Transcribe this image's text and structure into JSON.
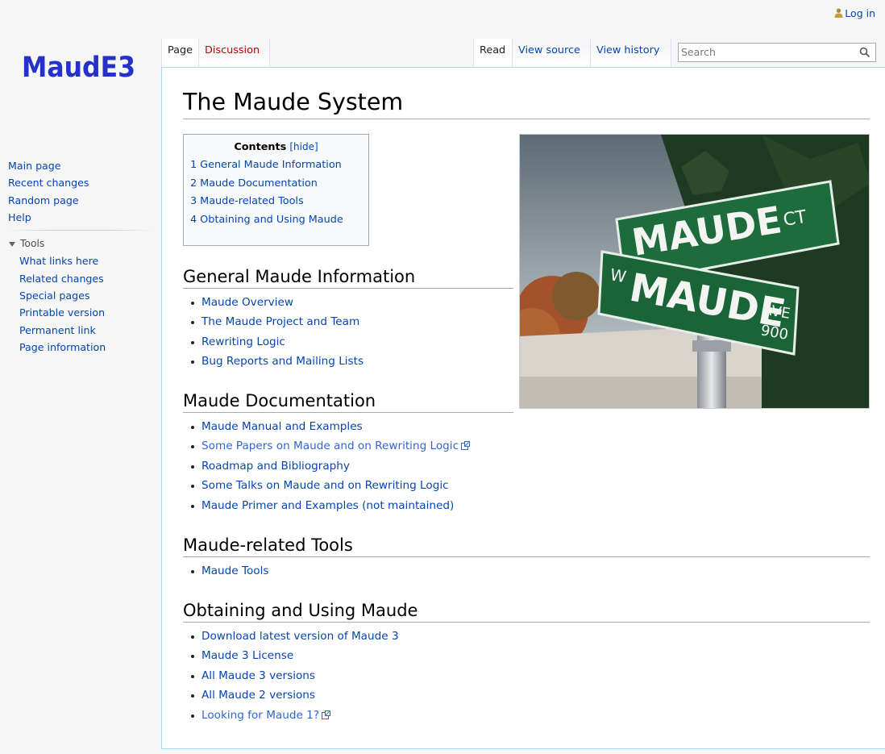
{
  "personal": {
    "login_label": "Log in"
  },
  "logo": {
    "text": "MaudE3"
  },
  "tabs": {
    "page": "Page",
    "discussion": "Discussion",
    "read": "Read",
    "view_source": "View source",
    "view_history": "View history"
  },
  "search": {
    "placeholder": "Search"
  },
  "sidebar": {
    "nav": [
      "Main page",
      "Recent changes",
      "Random page",
      "Help"
    ],
    "tools_heading": "Tools",
    "tools": [
      "What links here",
      "Related changes",
      "Special pages",
      "Printable version",
      "Permanent link",
      "Page information"
    ]
  },
  "page": {
    "title": "The Maude System"
  },
  "toc": {
    "title": "Contents",
    "toggle": "[hide]",
    "items": [
      {
        "num": "1",
        "label": "General Maude Information"
      },
      {
        "num": "2",
        "label": "Maude Documentation"
      },
      {
        "num": "3",
        "label": "Maude-related Tools"
      },
      {
        "num": "4",
        "label": "Obtaining and Using Maude"
      }
    ]
  },
  "image": {
    "sign_top": "MAUDE",
    "sign_top_suffix": "CT",
    "sign_bottom_prefix": "W",
    "sign_bottom": "MAUDE",
    "sign_bottom_suffix": "AVE",
    "sign_bottom_number": "900"
  },
  "sections": [
    {
      "heading": "General Maude Information",
      "links": [
        "Maude Overview",
        "The Maude Project and Team",
        "Rewriting Logic",
        "Bug Reports and Mailing Lists"
      ]
    },
    {
      "heading": "Maude Documentation",
      "links": [
        "Maude Manual and Examples",
        "Some Papers on Maude and on Rewriting Logic",
        "Roadmap and Bibliography",
        "Some Talks on Maude and on Rewriting Logic",
        "Maude Primer and Examples (not maintained)"
      ]
    },
    {
      "heading": "Maude-related Tools",
      "links": [
        "Maude Tools"
      ]
    },
    {
      "heading": "Obtaining and Using Maude",
      "links": [
        "Download latest version of Maude 3",
        "Maude 3 License",
        "All Maude 3 versions",
        "All Maude 2 versions",
        "Looking for Maude 1?"
      ]
    }
  ],
  "colors": {
    "link": "#0645ad",
    "external_link": "#3366cc",
    "red_link": "#ba0000",
    "content_border": "#a7d7f9"
  }
}
